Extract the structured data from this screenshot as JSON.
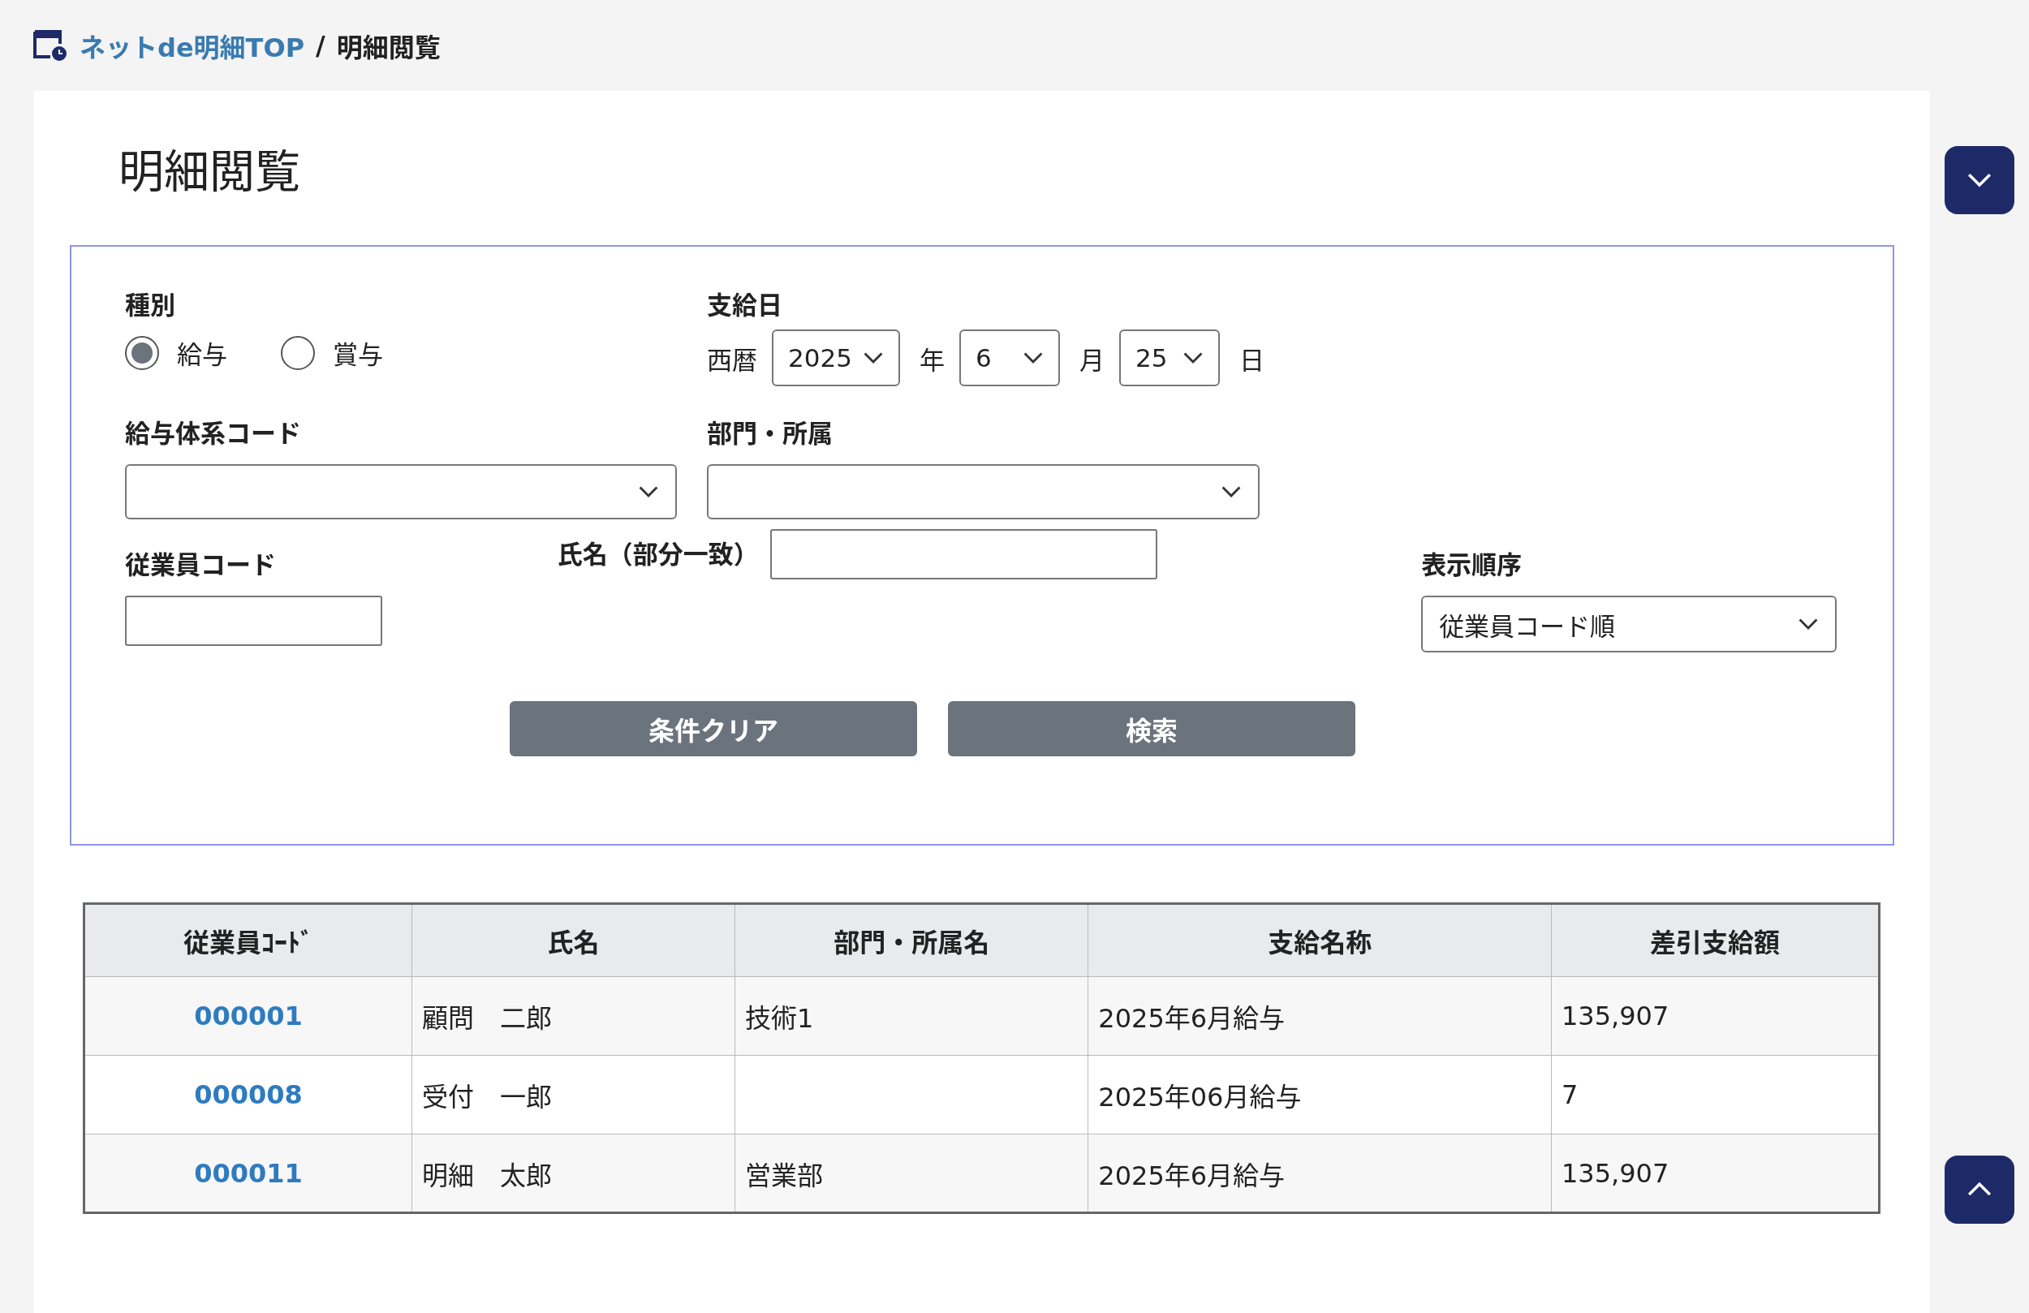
{
  "breadcrumb": {
    "link": "ネットde明細TOP",
    "separator": "/",
    "current": "明細閲覧"
  },
  "title": "明細閲覧",
  "search_form": {
    "type": {
      "label": "種別",
      "options": [
        {
          "label": "給与",
          "selected": true
        },
        {
          "label": "賞与",
          "selected": false
        }
      ]
    },
    "pay_date": {
      "label": "支給日",
      "era": "西暦",
      "parts": [
        {
          "value": "2025",
          "unit": "年"
        },
        {
          "value": "6",
          "unit": "月"
        },
        {
          "value": "25",
          "unit": "日"
        }
      ]
    },
    "salary_system_code": {
      "label": "給与体系コード"
    },
    "department": {
      "label": "部門・所属"
    },
    "employee_code": {
      "label": "従業員コード"
    },
    "name": {
      "label": "氏名（部分一致）"
    },
    "sort_order": {
      "label": "表示順序",
      "value": "従業員コード順"
    },
    "buttons": [
      "条件クリア",
      "検索"
    ]
  },
  "table": {
    "columns": [
      "従業員ｺｰﾄﾞ",
      "氏名",
      "部門・所属名",
      "支給名称",
      "差引支給額"
    ],
    "rows": [
      {
        "code": "000001",
        "name": "顧問　二郎",
        "department": "技術1",
        "payment": "2025年6月給与",
        "net": "135,907"
      },
      {
        "code": "000008",
        "name": "受付　一郎",
        "department": "",
        "payment": "2025年06月給与",
        "net": "7"
      },
      {
        "code": "000011",
        "name": "明細　太郎",
        "department": "営業部",
        "payment": "2025年6月給与",
        "net": "135,907"
      }
    ]
  }
}
